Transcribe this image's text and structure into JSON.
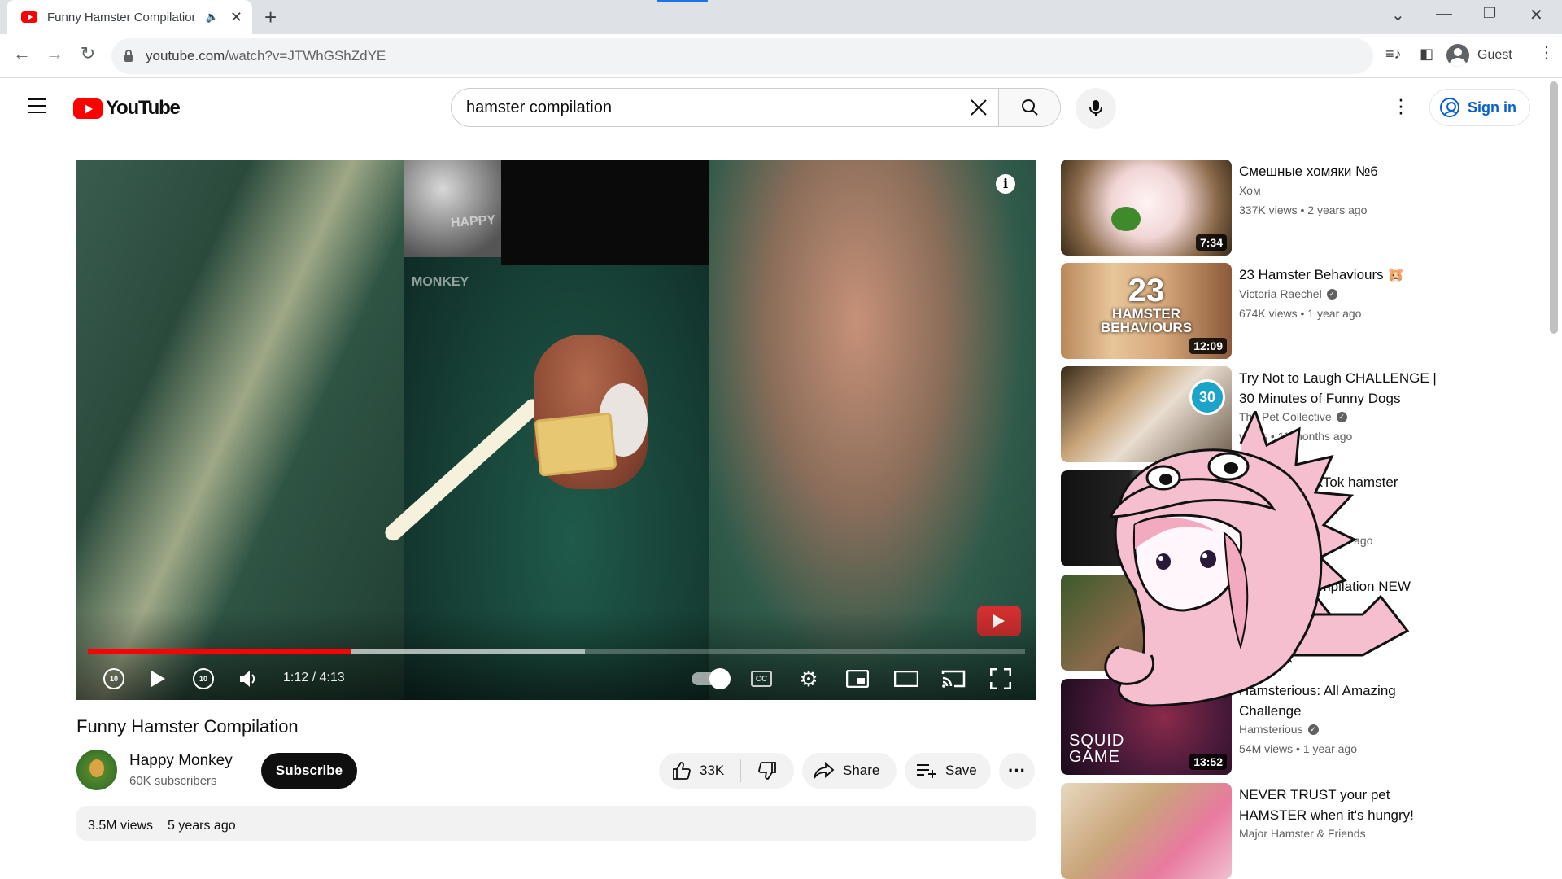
{
  "browser": {
    "tab_title": "Funny Hamster Compilation",
    "url_domain": "youtube.com",
    "url_path": "/watch?v=JTWhGShZdYE",
    "profile_label": "Guest"
  },
  "masthead": {
    "logo_text": "YouTube",
    "search_value": "hamster compilation",
    "signin_label": "Sign in"
  },
  "player": {
    "watermark_line1": "HAPPY",
    "watermark_line2": "MONKEY",
    "time_display": "1:12 / 4:13",
    "played_fraction": 0.28,
    "buffered_fraction": 0.53,
    "skip_seconds": "10"
  },
  "video": {
    "title": "Funny Hamster Compilation",
    "channel_name": "Happy Monkey",
    "subscribers": "60K subscribers",
    "subscribe_label": "Subscribe",
    "likes": "33K",
    "share_label": "Share",
    "save_label": "Save",
    "views": "3.5M views",
    "age": "5 years ago"
  },
  "recommendations": [
    {
      "title": "Смешные хомяки №6",
      "channel": "Хом",
      "verified": false,
      "views": "337K views",
      "age": "2 years ago",
      "duration": "7:34"
    },
    {
      "title": "23 Hamster Behaviours 🐹",
      "channel": "Victoria Raechel",
      "verified": true,
      "views": "674K views",
      "age": "1 year ago",
      "duration": "12:09",
      "thumb_text": [
        "23",
        "HAMSTER",
        "BEHAVIOURS"
      ]
    },
    {
      "title": "Try Not to Laugh CHALLENGE | 30 Minutes of Funny Dogs",
      "channel": "The Pet Collective",
      "verified": true,
      "views": "views",
      "age": "11 months ago",
      "duration": "",
      "thumb_badge": "30"
    },
    {
      "title": "s of TikTok hamster",
      "channel": "",
      "verified": false,
      "views": "",
      "age": "years ago",
      "duration": ""
    },
    {
      "title": "ompilation NEW",
      "channel": "",
      "verified": false,
      "views": "",
      "age": "go",
      "duration": ""
    },
    {
      "title": "Hamsterious: All Amazing Challenge",
      "channel": "Hamsterious",
      "verified": true,
      "views": "54M views",
      "age": "1 year ago",
      "duration": "13:52",
      "thumb_text": [
        "SQUID",
        "GAME"
      ]
    },
    {
      "title": "NEVER TRUST your pet HAMSTER when it's hungry!",
      "channel": "Major Hamster & Friends",
      "verified": false,
      "views": "",
      "age": "",
      "duration": ""
    }
  ],
  "colors": {
    "youtube_red": "#ff0000",
    "link_blue": "#065fd4",
    "progress_red": "#ff0000"
  }
}
